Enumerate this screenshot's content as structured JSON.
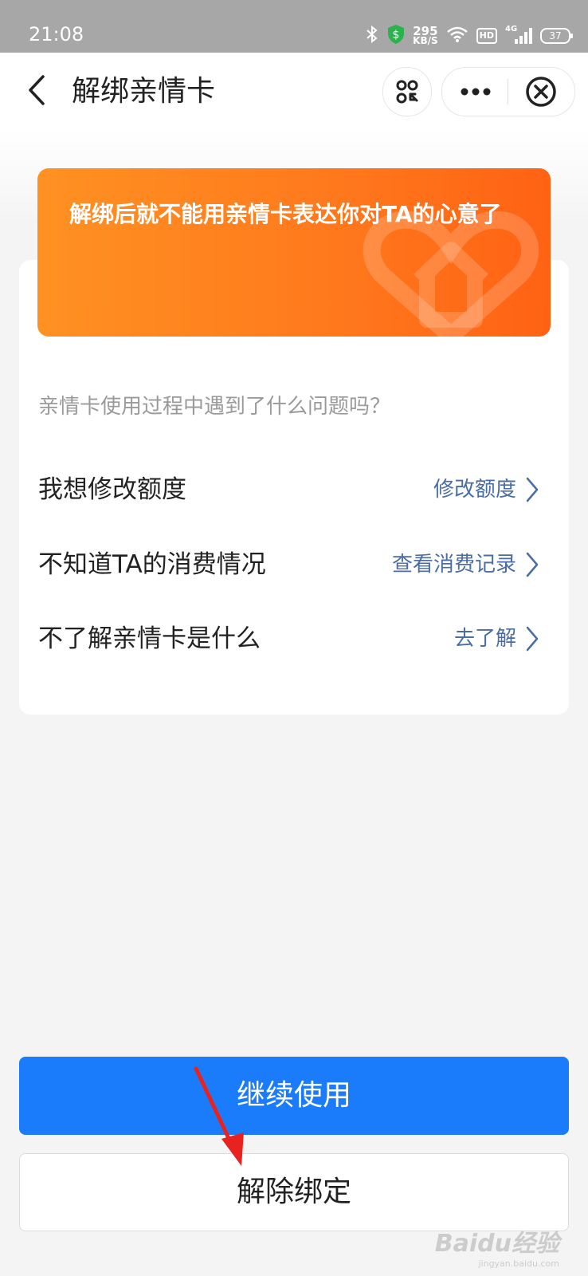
{
  "status_bar": {
    "time": "21:08",
    "net_speed": "295",
    "net_unit": "KB/S",
    "hd_label": "HD",
    "signal_label": "4G",
    "battery_level": "37"
  },
  "nav": {
    "title": "解绑亲情卡"
  },
  "banner": {
    "message": "解绑后就不能用亲情卡表达你对TA的心意了"
  },
  "help": {
    "question": "亲情卡使用过程中遇到了什么问题吗？",
    "rows": [
      {
        "label": "我想修改额度",
        "action": "修改额度"
      },
      {
        "label": "不知道TA的消费情况",
        "action": "查看消费记录"
      },
      {
        "label": "不了解亲情卡是什么",
        "action": "去了解"
      }
    ]
  },
  "buttons": {
    "continue_label": "继续使用",
    "unbind_label": "解除绑定"
  },
  "watermark": {
    "brand": "Baidu经验",
    "url": "jingyan.baidu.com"
  },
  "colors": {
    "primary": "#1a7cfb",
    "banner_start": "#ff9122",
    "banner_end": "#ff6213",
    "link": "#4a6ea3",
    "annotation_arrow": "#e8231f"
  }
}
